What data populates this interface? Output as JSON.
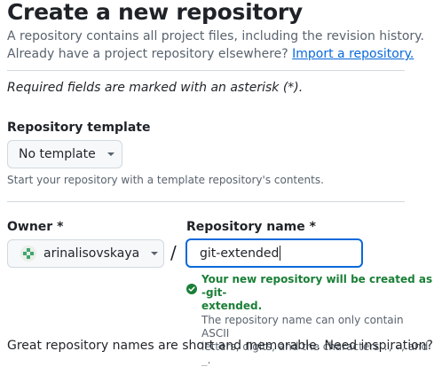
{
  "header": {
    "title": "Create a new repository",
    "subtitle_line1": "A repository contains all project files, including the revision history.",
    "subtitle_line2": "Already have a project repository elsewhere?",
    "import_link": "Import a repository."
  },
  "required_note": "Required fields are marked with an asterisk (*).",
  "template": {
    "label": "Repository template",
    "selected": "No template",
    "help": "Start your repository with a template repository's contents."
  },
  "owner": {
    "label": "Owner *",
    "selected": "arinalisovskaya"
  },
  "separator": "/",
  "repo_name": {
    "label": "Repository name *",
    "value": "git-extended",
    "success_line1": "Your new repository will be created as -git-",
    "success_line2": "extended.",
    "info_line1": "The repository name can only contain ASCII",
    "info_line2_a": "letters, digits, and the characters",
    "info_chars": ".",
    "info_sep1": ",",
    "info_char2": "-",
    "info_sep2": ", and",
    "info_char3": "_",
    "info_end": "."
  },
  "footer_text": "Great repository names are short and memorable. Need inspiration?",
  "colors": {
    "accent": "#0969da",
    "success": "#1a7f37",
    "muted": "#59636e",
    "avatar": "#3fa66b"
  },
  "icons": [
    "chevron-down-icon",
    "check-circle-icon",
    "identicon-avatar"
  ]
}
